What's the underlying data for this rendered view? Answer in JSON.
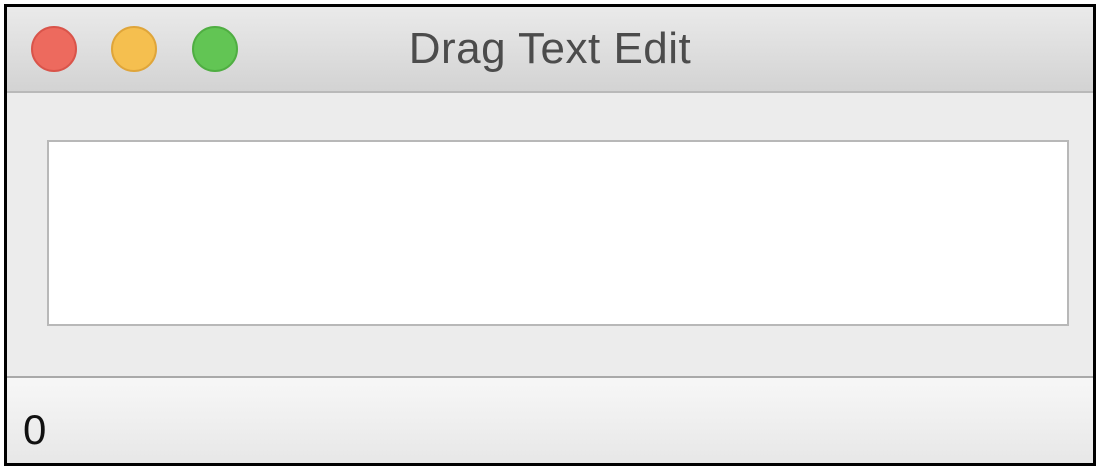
{
  "window": {
    "title": "Drag Text Edit"
  },
  "editor": {
    "value": ""
  },
  "statusbar": {
    "value": "0"
  },
  "colors": {
    "close": "#ed6a5e",
    "minimize": "#f5bf4f",
    "zoom": "#62c554"
  }
}
